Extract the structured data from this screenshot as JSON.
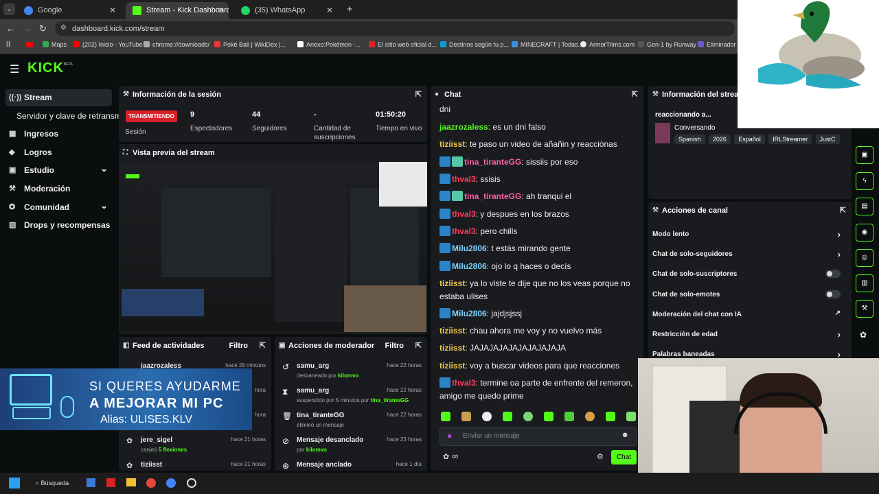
{
  "browser": {
    "tabs": [
      {
        "title": "Google",
        "color": "#4285f4"
      },
      {
        "title": "Stream - Kick Dashboard",
        "color": "#53fc18"
      },
      {
        "title": "(35) WhatsApp",
        "color": "#25d366"
      }
    ],
    "url": "dashboard.kick.com/stream",
    "bookmarks": [
      "Maps",
      "(202) Inicio - YouTube",
      "chrome://downloads/",
      "Poké Ball | WikiDex |...",
      "Anexo:Pokémon -...",
      "El sitio web oficial d...",
      "Destinos según tu p...",
      "MINECRAFT | Todas...",
      "ArmorTrims.com",
      "Gen-1 by Runway",
      "Eliminador d"
    ]
  },
  "kick": {
    "logo": "KICK",
    "beta": "BETA",
    "nav": [
      {
        "label": "Stream",
        "icon": "((·))"
      },
      {
        "label": "Servidor y clave de retransmisión",
        "icon": ""
      },
      {
        "label": "Ingresos",
        "icon": "▦"
      },
      {
        "label": "Logros",
        "icon": "◆"
      },
      {
        "label": "Estudio",
        "icon": "▣",
        "chev": "⌄"
      },
      {
        "label": "Moderación",
        "icon": "⚒"
      },
      {
        "label": "Comunidad",
        "icon": "✪",
        "chev": "⌄"
      },
      {
        "label": "Drops y recompensas",
        "icon": "▥"
      }
    ],
    "session": {
      "title": "Información de la sesión",
      "status": "TRANSMITIENDO",
      "status_label": "Sesión",
      "stats": [
        {
          "value": "9",
          "label": "Espectadores"
        },
        {
          "value": "44",
          "label": "Seguidores"
        },
        {
          "value": "-",
          "label": "Cantidad de suscripciones"
        },
        {
          "value": "01:50:20",
          "label": "Tiempo en vivo"
        }
      ]
    },
    "preview": {
      "title": "Vista previa del stream"
    },
    "feed": {
      "title": "Feed de actividades",
      "filter": "Filtro",
      "items": [
        {
          "name": "jaazrozaless",
          "sub": "",
          "time": "hace 29 minutos"
        },
        {
          "name": "",
          "sub": "",
          "time": "hora"
        },
        {
          "name": "",
          "sub": "",
          "time": "hora"
        },
        {
          "name": "jere_sigel",
          "sub": "canjeó",
          "hl": "5 flexiones",
          "time": "hace 21 horas"
        },
        {
          "name": "tiziisst",
          "sub": "",
          "time": "hace 21 horas"
        }
      ]
    },
    "modactions": {
      "title": "Acciones de moderador",
      "filter": "Filtro",
      "items": [
        {
          "icon": "↺",
          "name": "samu_arg",
          "sub": "desbaneado por",
          "by": "kilomvo",
          "time": "hace 22 horas"
        },
        {
          "icon": "⧗",
          "name": "samu_arg",
          "sub": "suspendido por 5 minutos por",
          "by": "tina_tiranteGG",
          "time": "hace 22 horas"
        },
        {
          "icon": "🗑",
          "name": "tina_tiranteGG",
          "sub": "eliminó un mensaje",
          "by": "",
          "time": "hace 22 horas"
        },
        {
          "icon": "⊘",
          "name": "Mensaje desanclado",
          "sub": "por",
          "by": "kilomvo",
          "time": "hace 23 horas"
        },
        {
          "icon": "⊕",
          "name": "Mensaje anclado",
          "sub": "",
          "by": "",
          "time": "hace 1 día"
        }
      ]
    },
    "chat": {
      "title": "Chat",
      "messages": [
        {
          "user": "",
          "color": "#eee",
          "text": "dni",
          "badge": ""
        },
        {
          "user": "jaazrozaless",
          "color": "#53fc18",
          "text": "es un dni falso",
          "badge": ""
        },
        {
          "user": "tiziisst",
          "color": "#f2c94c",
          "text": "te paso un video de añañin y reacciónas",
          "badge": ""
        },
        {
          "user": "tina_tiranteGG",
          "color": "#ff5ea8",
          "text": "sissiis por eso",
          "badge": "two"
        },
        {
          "user": "thval3",
          "color": "#ff3b5c",
          "text": "ssisis",
          "badge": "one"
        },
        {
          "user": "tina_tiranteGG",
          "color": "#ff5ea8",
          "text": "ah tranqui el",
          "badge": "two"
        },
        {
          "user": "thval3",
          "color": "#ff3b5c",
          "text": "y despues en los brazos",
          "badge": "one"
        },
        {
          "user": "thval3",
          "color": "#ff3b5c",
          "text": "pero chills",
          "badge": "one"
        },
        {
          "user": "Milu2806",
          "color": "#7ed4ff",
          "text": "t estás mirando gente",
          "badge": "one"
        },
        {
          "user": "Milu2806",
          "color": "#7ed4ff",
          "text": "ojo lo q haces o decís",
          "badge": "one"
        },
        {
          "user": "tiziisst",
          "color": "#f2c94c",
          "text": "ya lo viste te dije que no los veas porque no estaba ulises",
          "badge": ""
        },
        {
          "user": "Milu2806",
          "color": "#7ed4ff",
          "text": "jajdjsjssj",
          "badge": "one"
        },
        {
          "user": "tiziisst",
          "color": "#f2c94c",
          "text": "chau ahora me voy y no vuelvo más",
          "badge": ""
        },
        {
          "user": "tiziisst",
          "color": "#f2c94c",
          "text": "JAJAJAJAJAJAJAJAJAJA",
          "badge": ""
        },
        {
          "user": "tiziisst",
          "color": "#f2c94c",
          "text": "voy a buscar videos para que reacciones",
          "badge": ""
        },
        {
          "user": "thval3",
          "color": "#ff3b5c",
          "text": "termine oa parte de enfrente del remeron, amigo me quedo prime",
          "badge": "one"
        }
      ],
      "input_placeholder": "Enviar un mensaje",
      "send_label": "Chat"
    },
    "streaminfo": {
      "title": "Información del stream",
      "stream_title": "reaccionando a...",
      "category": "Conversando",
      "tags": [
        "Spanish",
        "2026",
        "Español",
        "IRLStreamer",
        "JustC"
      ]
    },
    "channel": {
      "title": "Acciones de canal",
      "items": [
        {
          "label": "Modo lento",
          "ctrl": "chev"
        },
        {
          "label": "Chat de solo-seguidores",
          "ctrl": "chev"
        },
        {
          "label": "Chat de solo-suscriptores",
          "ctrl": "toggle"
        },
        {
          "label": "Chat de solo-emotes",
          "ctrl": "toggle"
        },
        {
          "label": "Moderación del chat con IA",
          "ctrl": "ext"
        },
        {
          "label": "Restricción de edad",
          "ctrl": "chev"
        },
        {
          "label": "Palabras baneadas",
          "ctrl": "chev"
        }
      ]
    }
  },
  "overlay": {
    "line1": "SI QUERES AYUDARME",
    "line2": "A MEJORAR MI PC",
    "line3": "Alias: ULISES.KLV"
  },
  "taskbar": {
    "search": "Búsqueda"
  }
}
